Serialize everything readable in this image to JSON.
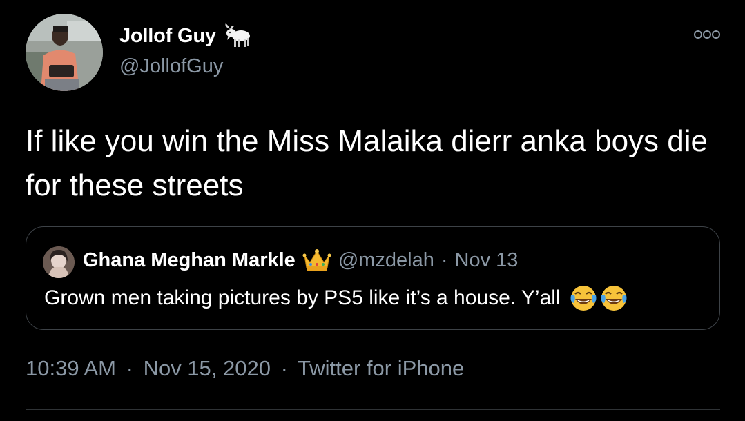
{
  "author": {
    "display_name": "Jollof Guy",
    "handle": "@JollofGuy",
    "name_emoji": "goat-icon"
  },
  "tweet": {
    "text": "If like you win the Miss Malaika dierr anka boys die for these streets"
  },
  "quoted_tweet": {
    "display_name": "Ghana Meghan Markle",
    "name_emoji": "crown-icon",
    "handle": "@mzdelah",
    "separator": "·",
    "date": "Nov 13",
    "text": "Grown men taking pictures by PS5 like it’s a house. Y’all",
    "trailing_emojis": [
      "tears-of-joy-icon",
      "tears-of-joy-icon"
    ]
  },
  "meta": {
    "time": "10:39 AM",
    "separator1": "·",
    "date": "Nov 15, 2020",
    "separator2": "·",
    "source": "Twitter for iPhone"
  },
  "colors": {
    "background": "#000000",
    "primary_text": "#ffffff",
    "secondary_text": "#8b98a5",
    "border": "#3d4247",
    "divider": "#2f3336"
  }
}
